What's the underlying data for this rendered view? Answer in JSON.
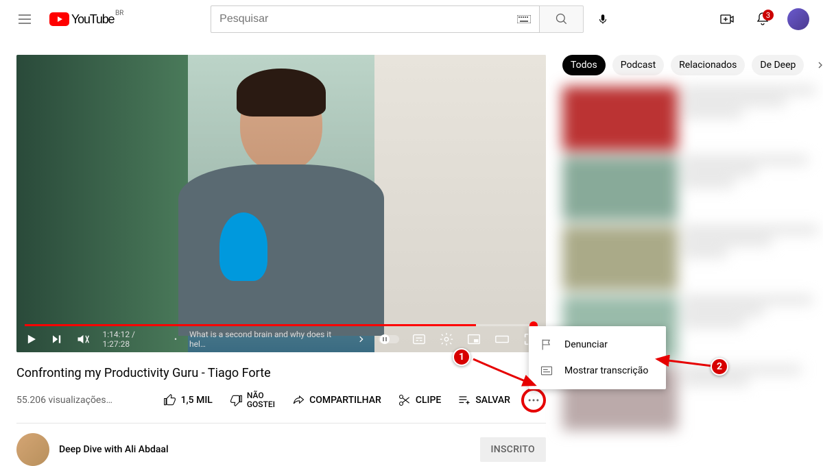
{
  "header": {
    "logo_text": "YouTube",
    "locale_badge": "BR",
    "search_placeholder": "Pesquisar",
    "notification_count": "3"
  },
  "player": {
    "current_time": "1:14:12",
    "duration": "1:27:28",
    "chapter": "What is a second brain and why does it hel…"
  },
  "video": {
    "title": "Confronting my Productivity Guru - Tiago Forte",
    "views": "55.206 visualizações…",
    "like_count": "1,5 MIL",
    "dislike_line1": "NÃO",
    "dislike_line2": "GOSTEI",
    "share_label": "COMPARTILHAR",
    "clip_label": "CLIPE",
    "save_label": "SALVAR",
    "channel_name": "Deep Dive with Ali Abdaal",
    "subscribe_label": "INSCRITO"
  },
  "menu": {
    "report": "Denunciar",
    "transcript": "Mostrar transcrição"
  },
  "chips": {
    "all": "Todos",
    "podcast": "Podcast",
    "related": "Relacionados",
    "from_channel": "De Deep"
  },
  "annotations": {
    "badge1": "1",
    "badge2": "2"
  }
}
